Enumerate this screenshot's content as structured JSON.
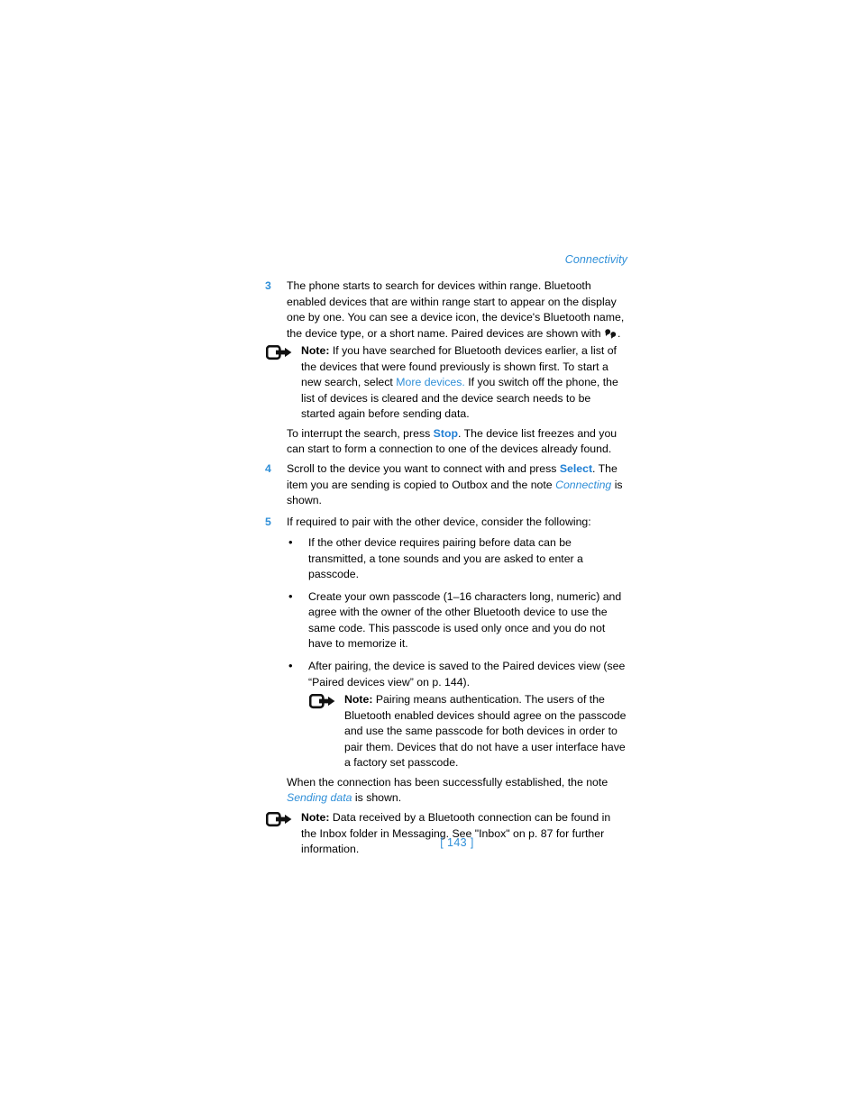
{
  "running_head": "Connectivity",
  "accent_blue": "#2f8fd8",
  "link_blue": "#1f7fd4",
  "folio": "[ 143 ]",
  "note_label": "Note:",
  "bullet_glyph": "•",
  "steps": [
    {
      "number": "3",
      "text": "The phone starts to search for devices within range. Bluetooth enabled devices that are within range start to appear on the display one by one. You can see a device icon, the device's Bluetooth name, the device type, or a short name. Paired devices are shown with",
      "text_tail": "."
    },
    {
      "number": "4",
      "text_a": "Scroll to the device you want to connect with and press ",
      "link_a": "Select",
      "text_b": ". The item you are sending is copied to Outbox and the note ",
      "link_b": "Connecting",
      "text_c": " is shown."
    },
    {
      "number": "5",
      "text": "If required to pair with the other device, consider the following:"
    }
  ],
  "notes": {
    "more_devices": {
      "text_a": "If you have searched for Bluetooth devices earlier, a list of the devices that were found previously is shown first. To start a new search, select ",
      "link": "More devices.",
      "text_b": " If you switch off the phone, the list of devices is cleared and the device search needs to be started again before sending data."
    },
    "pairing": {
      "text": "Pairing means authentication. The users of the Bluetooth enabled devices should agree on the passcode and use the same passcode for both devices in order to pair them. Devices that do not have a user interface have a factory set passcode."
    },
    "inbox": {
      "text": "Data received by a Bluetooth connection can be found in the Inbox folder in Messaging. See \"Inbox\" on p. 87 for further information."
    }
  },
  "interrupt_para": {
    "text_a": "To interrupt the search, press ",
    "link": "Stop",
    "text_b": ". The device list freezes and you can start to form a connection to one of the devices already found."
  },
  "bullets": [
    {
      "text": "If the other device requires pairing before data can be transmitted, a tone sounds and you are asked to enter a passcode."
    },
    {
      "text": "Create your own passcode (1–16 characters long, numeric) and agree with the owner of the other Bluetooth device to use the same code. This passcode is used only once and you do not have to memorize it."
    },
    {
      "text": "After pairing, the device is saved to the Paired devices view (see “Paired devices view” on p. 144)."
    }
  ],
  "closing_para": {
    "text_a": "When the connection has been successfully established, the note ",
    "link": "Sending data",
    "text_b": " is shown."
  },
  "icons": {
    "note": "note-callout-icon",
    "paired_devices": "paired-devices-icon"
  }
}
